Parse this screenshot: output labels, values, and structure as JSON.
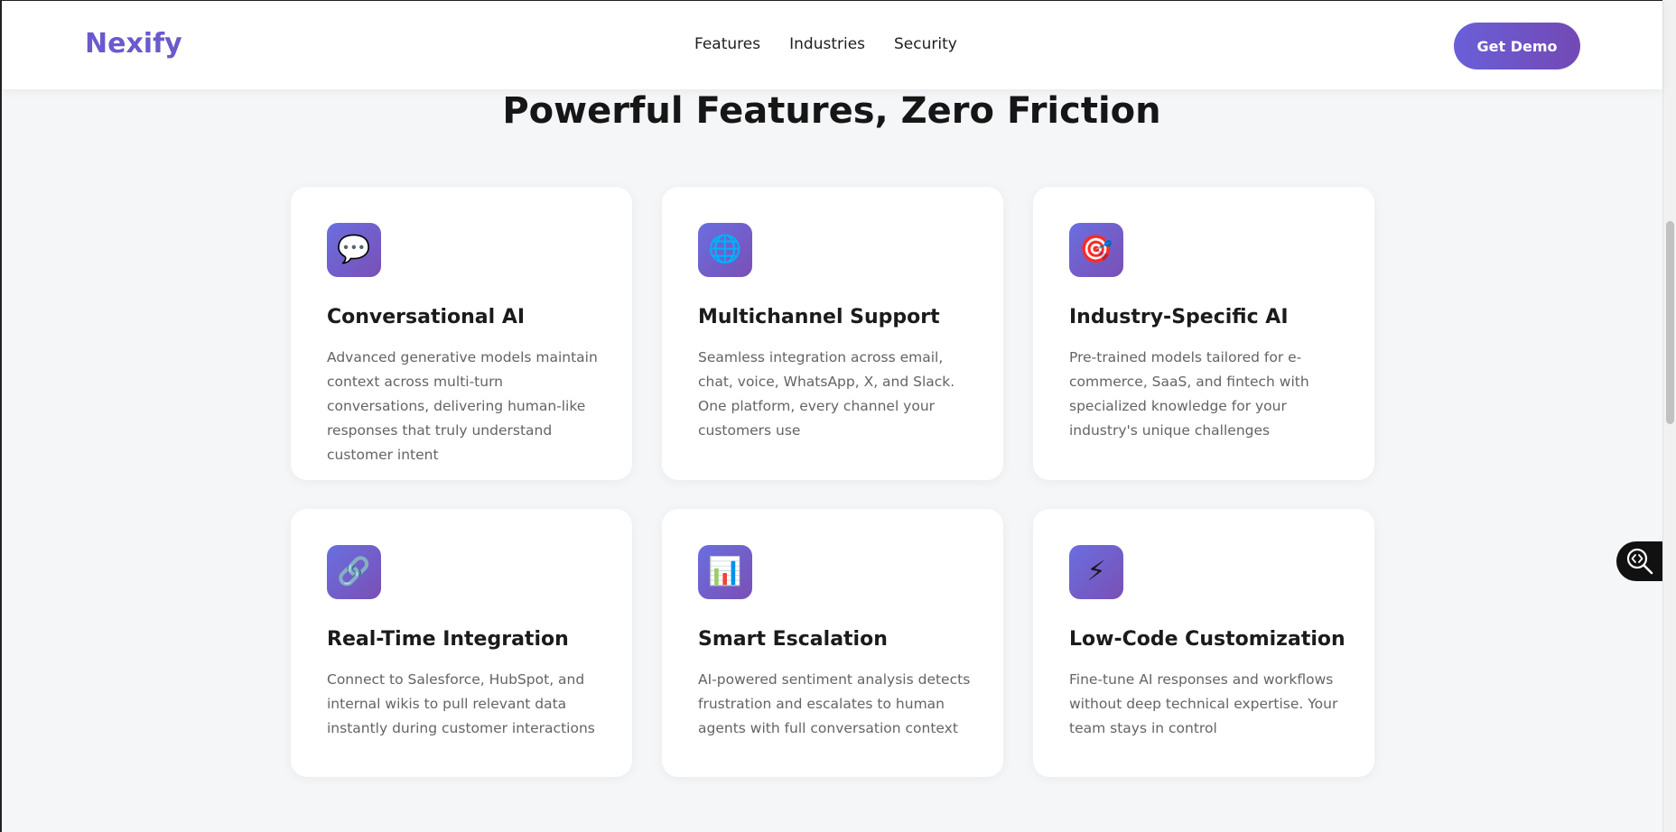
{
  "header": {
    "logo": "Nexify",
    "nav": [
      "Features",
      "Industries",
      "Security"
    ],
    "cta_label": "Get Demo"
  },
  "section": {
    "title": "Powerful Features, Zero Friction"
  },
  "features": [
    {
      "icon": "speech-bubble-icon",
      "glyph": "💬",
      "title": "Conversational AI",
      "description": "Advanced generative models maintain context across multi-turn conversations, delivering human-like responses that truly understand customer intent"
    },
    {
      "icon": "globe-icon",
      "glyph": "🌐",
      "title": "Multichannel Support",
      "description": "Seamless integration across email, chat, voice, WhatsApp, X, and Slack. One platform, every channel your customers use"
    },
    {
      "icon": "target-icon",
      "glyph": "🎯",
      "title": "Industry-Specific AI",
      "description": "Pre-trained models tailored for e-commerce, SaaS, and fintech with specialized knowledge for your industry's unique challenges"
    },
    {
      "icon": "link-icon",
      "glyph": "🔗",
      "title": "Real-Time Integration",
      "description": "Connect to Salesforce, HubSpot, and internal wikis to pull relevant data instantly during customer interactions"
    },
    {
      "icon": "bar-chart-icon",
      "glyph": "📊",
      "title": "Smart Escalation",
      "description": "AI-powered sentiment analysis detects frustration and escalates to human agents with full conversation context"
    },
    {
      "icon": "lightning-icon",
      "glyph": "⚡",
      "title": "Low-Code Customization",
      "description": "Fine-tune AI responses and workflows without deep technical expertise. Your team stays in control"
    }
  ],
  "colors": {
    "brand": "#6a5acd",
    "cta_gradient_start": "#6a5fd8",
    "cta_gradient_end": "#7349b4",
    "background": "#f5f6f8"
  },
  "floating_widget": {
    "icon": "code-search-icon"
  }
}
